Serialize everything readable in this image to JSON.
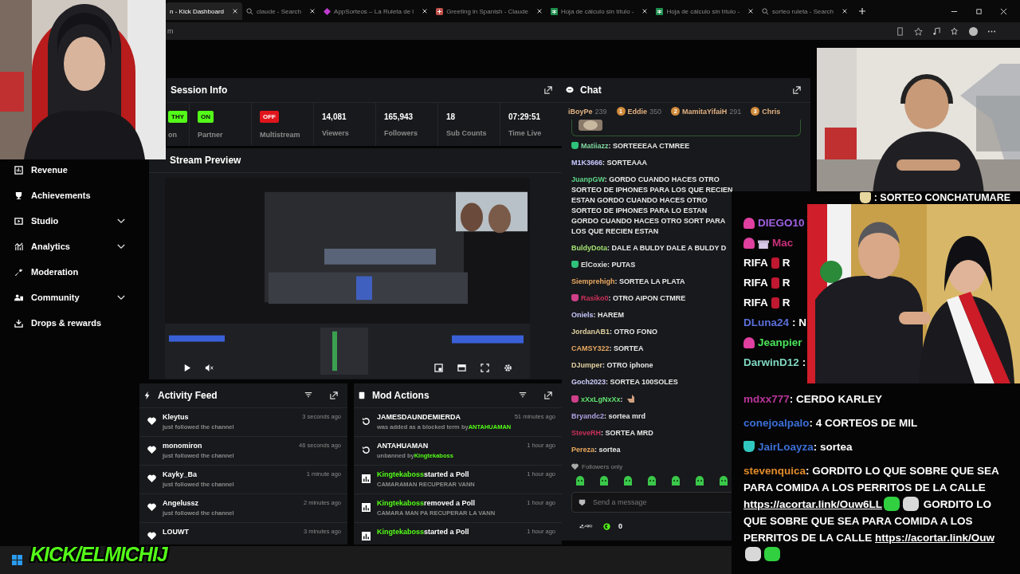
{
  "browser": {
    "tabs": [
      {
        "title": "n - Kick Dashboard",
        "kind": "plain",
        "selected": true
      },
      {
        "title": "claude - Search",
        "kind": "search",
        "selected": false
      },
      {
        "title": "AppSorteos – La Ruleta de l",
        "kind": "app",
        "selected": false
      },
      {
        "title": "Greeting in Spanish - Claude",
        "kind": "claude",
        "selected": false
      },
      {
        "title": "Hoja de cálculo sin título -",
        "kind": "sheet",
        "selected": false
      },
      {
        "title": "Hoja de cálculo sin título -",
        "kind": "sheet",
        "selected": false
      },
      {
        "title": "sorteo ruleta - Search",
        "kind": "search",
        "selected": false
      }
    ],
    "address": "m"
  },
  "sidebar": {
    "items": [
      {
        "label": "Revenue",
        "kind": "revenue",
        "submenu": false
      },
      {
        "label": "Achievements",
        "kind": "trophy",
        "submenu": false
      },
      {
        "label": "Studio",
        "kind": "studio",
        "submenu": true
      },
      {
        "label": "Analytics",
        "kind": "analytics",
        "submenu": true
      },
      {
        "label": "Moderation",
        "kind": "wrench",
        "submenu": false
      },
      {
        "label": "Community",
        "kind": "community",
        "submenu": true
      },
      {
        "label": "Drops & rewards",
        "kind": "download",
        "submenu": false
      }
    ]
  },
  "session_info": {
    "title": "Session Info",
    "badges": [
      {
        "value": "THY",
        "label": "on",
        "on": true
      },
      {
        "value": "ON",
        "label": "Partner",
        "on": true
      },
      {
        "value": "OFF",
        "label": "Multistream",
        "on": false
      }
    ],
    "stats": [
      {
        "value": "14,081",
        "label": "Viewers"
      },
      {
        "value": "165,943",
        "label": "Followers"
      },
      {
        "value": "18",
        "label": "Sub Counts"
      },
      {
        "value": "07:29:51",
        "label": "Time Live"
      }
    ]
  },
  "stream_preview": {
    "title": "Stream Preview"
  },
  "activity_feed": {
    "title": "Activity Feed",
    "items": [
      {
        "user": "Kleytus",
        "action": "just followed the channel",
        "time": "3 seconds ago"
      },
      {
        "user": "monomiron",
        "action": "just followed the channel",
        "time": "46 seconds ago"
      },
      {
        "user": "Kayky_Ba",
        "action": "just followed the channel",
        "time": "1 minute ago"
      },
      {
        "user": "Angelussz",
        "action": "just followed the channel",
        "time": "2 minutes ago"
      },
      {
        "user": "LOUWT",
        "time": "3 minutes ago"
      }
    ]
  },
  "mod_actions": {
    "title": "Mod Actions",
    "items": [
      {
        "kind": "unban",
        "title": "JAMESDAUNDEMIERDA",
        "sub": "was added as a blocked term by",
        "sub_user": "ANTAHUAMAN",
        "time": "51 minutes ago"
      },
      {
        "kind": "unban",
        "title": "ANTAHUAMAN",
        "sub": "unbanned by",
        "sub_user": "Kingtekaboss",
        "time": "1 hour ago"
      },
      {
        "kind": "poll",
        "actor": "Kingtekaboss",
        "title": "started a Poll",
        "sub": "CAMARAMAN RECUPERAR VANN",
        "time": "1 hour ago"
      },
      {
        "kind": "poll",
        "actor": "Kingtekaboss",
        "title": "removed a Poll",
        "sub": "CAMARA MAN PA RECUPERAR LA VANN",
        "time": "1 hour ago"
      },
      {
        "kind": "poll",
        "actor": "Kingtekaboss",
        "title": "started a Poll",
        "time": "1 hour ago"
      }
    ]
  },
  "chat": {
    "title": "Chat",
    "leaderboard": [
      {
        "name": "iBoyPe",
        "points": "239"
      },
      {
        "rank": "1",
        "name": "Eddie",
        "points": "350"
      },
      {
        "rank": "2",
        "name": "MamitaYifaiH",
        "points": "291"
      },
      {
        "rank": "3",
        "name": "Chris"
      }
    ],
    "messages": [
      {
        "user": "Matiiazz",
        "color": "#7fd6a0",
        "badge": {
          "color": "#2fc27a"
        },
        "text": ": SORTEEEAA CTMREE",
        "emote": false
      },
      {
        "user": "M1K3666",
        "color": "#c8c8ff",
        "text": ": SORTEAAA",
        "emote": false
      },
      {
        "user": "JuanpGW",
        "color": "#5fd68a",
        "text": ": GORDO CUANDO HACES OTRO SORTEO DE IPHONES PARA LOS QUE RECIEN ESTAN GORDO CUANDO HACES OTRO SORTEO DE IPHONES PARA LO ESTAN GORDO CUANDO HACES OTRO SORT PARA LOS QUE RECIEN ESTAN",
        "emote": false
      },
      {
        "user": "BuldyDota",
        "color": "#a0e070",
        "text": ": DALE A BULDY DALE A BULDY D",
        "emote": false
      },
      {
        "user": "ElCoxie",
        "color": "#e0e0e0",
        "badge": {
          "color": "#2fc27a"
        },
        "text": ": PUTAS",
        "emote": false
      },
      {
        "user": "Siemprehigh",
        "color": "#e8a860",
        "text": ": SORTEA LA PLATA",
        "emote": false
      },
      {
        "user": "Rasiko0",
        "color": "#c8305a",
        "badge": {
          "color": "#d0408a"
        },
        "text": ": OTRO AIPON CTMRE",
        "emote": false
      },
      {
        "user": "Oniels",
        "color": "#c8c8ff",
        "text": ": HAREM",
        "emote": false
      },
      {
        "user": "JordanAB1",
        "color": "#e0d0a0",
        "text": ": OTRO FONO",
        "emote": false
      },
      {
        "user": "CAMSY322",
        "color": "#e8a860",
        "text": ": SORTEA",
        "emote": false
      },
      {
        "user": "DJumper",
        "color": "#e0d0a0",
        "text": ": OTRO iphone",
        "emote": false
      },
      {
        "user": "Goch2023",
        "color": "#d0d0ff",
        "text": ": SORTEA 100SOLES",
        "emote": false
      },
      {
        "user": "xXxLgNxXx",
        "color": "#5fe070",
        "badge": {
          "color": "#d0408a"
        },
        "text": ":",
        "emote": true
      },
      {
        "user": "Bryandc2",
        "color": "#b0a0e0",
        "text": ": sortea mrd",
        "emote": false
      },
      {
        "user": "SteveRH",
        "color": "#c8305a",
        "text": ": SORTEA MRD",
        "emote": false
      },
      {
        "user": "Pereza",
        "color": "#e8a860",
        "text": ": sortea",
        "emote": false
      }
    ],
    "followers_only": "Followers only",
    "input": {
      "placeholder": "Send a message"
    },
    "count": "0"
  },
  "overlay_chat": {
    "top": {
      "badge": {
        "color": "#e8d8a0"
      },
      "segments": [
        {
          "kind": "text",
          "text": ": SORTEO CONCHATUMARE"
        }
      ]
    },
    "beside": [
      {
        "user": "DIEGO10",
        "color": "#a060e0",
        "badge": {
          "color": "#e040a0"
        }
      },
      {
        "user": "Mac",
        "color": "#c8307a",
        "badge": {
          "color": "#e040a0"
        },
        "gift": true
      },
      {
        "segments": [
          {
            "kind": "text",
            "text": "RIFA"
          },
          {
            "kind": "emote",
            "color": "#c01830"
          },
          {
            "kind": "text",
            "text": "R"
          }
        ]
      },
      {
        "segments": [
          {
            "kind": "text",
            "text": "RIFA"
          },
          {
            "kind": "emote",
            "color": "#c01830"
          },
          {
            "kind": "text",
            "text": "R"
          }
        ]
      },
      {
        "segments": [
          {
            "kind": "text",
            "text": "RIFA"
          },
          {
            "kind": "emote",
            "color": "#c01830"
          },
          {
            "kind": "text",
            "text": "R"
          }
        ]
      },
      {
        "user": "DLuna24",
        "color": "#5a6fd8",
        "segments": [
          {
            "kind": "text",
            "text": ": N"
          }
        ]
      },
      {
        "user": "Jeanpier",
        "color": "#4be35a",
        "badge": {
          "color": "#e040a0"
        }
      },
      {
        "user": "DarwinD12",
        "color": "#7fd6c0",
        "segments": [
          {
            "kind": "text",
            "text": ":"
          }
        ]
      }
    ],
    "messages": [
      {
        "user": "mdxx777",
        "color": "#b8359b",
        "segments": [
          {
            "kind": "text",
            "text": ": CERDO KARLEY"
          }
        ]
      },
      {
        "user": "conejoalpalo",
        "color": "#3b6fd6",
        "segments": [
          {
            "kind": "text",
            "text": ": 4 CORTEOS DE MIL"
          }
        ]
      },
      {
        "user": "JairLoayza",
        "color": "#3b6fd6",
        "badge": {
          "color": "#30c8c0"
        },
        "segments": [
          {
            "kind": "text",
            "text": ": sortea"
          }
        ]
      },
      {
        "user": "stevenquica",
        "color": "#e08a2a",
        "segments": [
          {
            "kind": "text",
            "text": ": GORDITO LO QUE SOBRE QUE SEA PARA COMIDA A LOS PERRITOS DE LA CALLE "
          },
          {
            "kind": "link",
            "text": "https://acortar.link/Ouw6LL"
          },
          {
            "kind": "emote",
            "color": "#30d040"
          },
          {
            "kind": "emote",
            "color": "#d8d8d8"
          },
          {
            "kind": "text",
            "text": " GORDITO LO QUE SOBRE QUE SEA PARA COMIDA A LOS PERRITOS DE LA CALLE "
          },
          {
            "kind": "link",
            "text": "https://acortar.link/Ouw"
          },
          {
            "kind": "emote",
            "color": "#d8d8d8"
          },
          {
            "kind": "emote",
            "color": "#30d040"
          }
        ]
      }
    ]
  },
  "brand": "KICK/ELMICHIJ"
}
